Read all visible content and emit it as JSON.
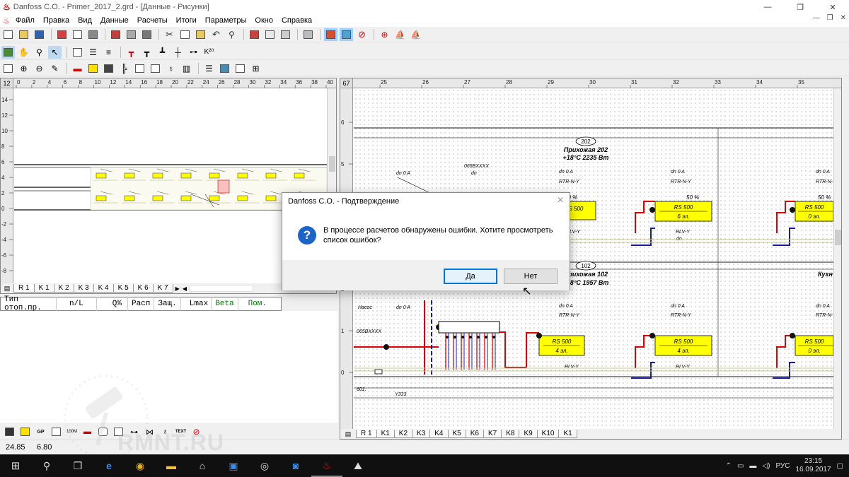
{
  "window": {
    "title": "Danfoss C.O. - Primer_2017_2.grd - [Данные - Рисунки]",
    "controls": [
      "—",
      "❐",
      "✕"
    ]
  },
  "menu": [
    "Файл",
    "Правка",
    "Вид",
    "Данные",
    "Расчеты",
    "Итоги",
    "Параметры",
    "Окно",
    "Справка"
  ],
  "mdi_controls": [
    "—",
    "❐",
    "✕"
  ],
  "left_ruler": {
    "corner": "12",
    "x": [
      "0",
      "2",
      "4",
      "6",
      "8",
      "10",
      "12",
      "14",
      "16",
      "18",
      "20",
      "22",
      "24",
      "26",
      "28",
      "30",
      "32",
      "34",
      "36",
      "38",
      "40"
    ],
    "y": [
      "14",
      "12",
      "10",
      "8",
      "6",
      "4",
      "2",
      "0",
      "-2",
      "-4",
      "-6",
      "-8"
    ]
  },
  "left_tabs": [
    "R 1",
    "K 1",
    "K 2",
    "K 3",
    "K 4",
    "K 5",
    "K 6",
    "K 7"
  ],
  "table_header": [
    "Тип отоп.пр.",
    "n/L",
    "Q%",
    "Расп",
    "Защ.",
    "Lmax",
    "Beta",
    "Пом."
  ],
  "bottom_toolbar_labels": {
    "gp": "GP",
    "text": "TEXT",
    "e100": "100M"
  },
  "status": {
    "x": "24.85",
    "y": "6.80"
  },
  "right_ruler": {
    "corner": "67",
    "x": [
      "25",
      "26",
      "27",
      "28",
      "29",
      "30",
      "31",
      "32",
      "33",
      "34",
      "35"
    ],
    "y": [
      "6",
      "5",
      "4",
      "3",
      "2",
      "1",
      "0"
    ]
  },
  "right_tabs": [
    "R 1",
    "K1",
    "K2",
    "K3",
    "K4",
    "K5",
    "K6",
    "K7",
    "K8",
    "K9",
    "K10",
    "K1"
  ],
  "drawing": {
    "room1_number": "202",
    "room1_name": "Прихожая 202",
    "room1_temp": "+18°C 2235 Вт",
    "room2_number": "102",
    "room2_name": "Прихожая 102",
    "room2_temp": "+18°C 1957 Вт",
    "room3_name": "Кухн",
    "label_dn0A": "dn 0 A",
    "label_rtr": "RTR-N-Y",
    "label_rlv": "RLV-Y",
    "label_dn": "dn",
    "label_pct": "50 %",
    "label_065": "065BXXXX",
    "label_pump": "Насос",
    "label_601": "601.",
    "label_y333": "Y333",
    "rad_top": [
      {
        "type": "RS 500",
        "sections": "6 эл."
      },
      {
        "type": "RS 500",
        "sections": "0 эл."
      }
    ],
    "rad_bottom": [
      {
        "type": "RS 500",
        "sections": "4 эл."
      },
      {
        "type": "RS 500",
        "sections": "4 эл."
      },
      {
        "type": "RS 500",
        "sections": "0 эл."
      }
    ],
    "rad_partial_label": "RS 500",
    "rad_partial_sub": "4 эл."
  },
  "dialog": {
    "title": "Danfoss C.O. - Подтверждение",
    "message": "В процессе расчетов обнаружены ошибки. Хотите просмотреть список ошибок?",
    "yes": "Да",
    "no": "Нет",
    "close": "✕",
    "icon": "?"
  },
  "taskbar": {
    "lang": "РУС",
    "time": "23:15",
    "date": "16.09.2017"
  },
  "watermark": "RMNT.RU",
  "colors": {
    "accent": "#0078d7",
    "radiator": "#ffff00",
    "pipe_red": "#e00000",
    "pipe_blue": "#1a1aa0",
    "icon_blue": "#1e64c8"
  }
}
